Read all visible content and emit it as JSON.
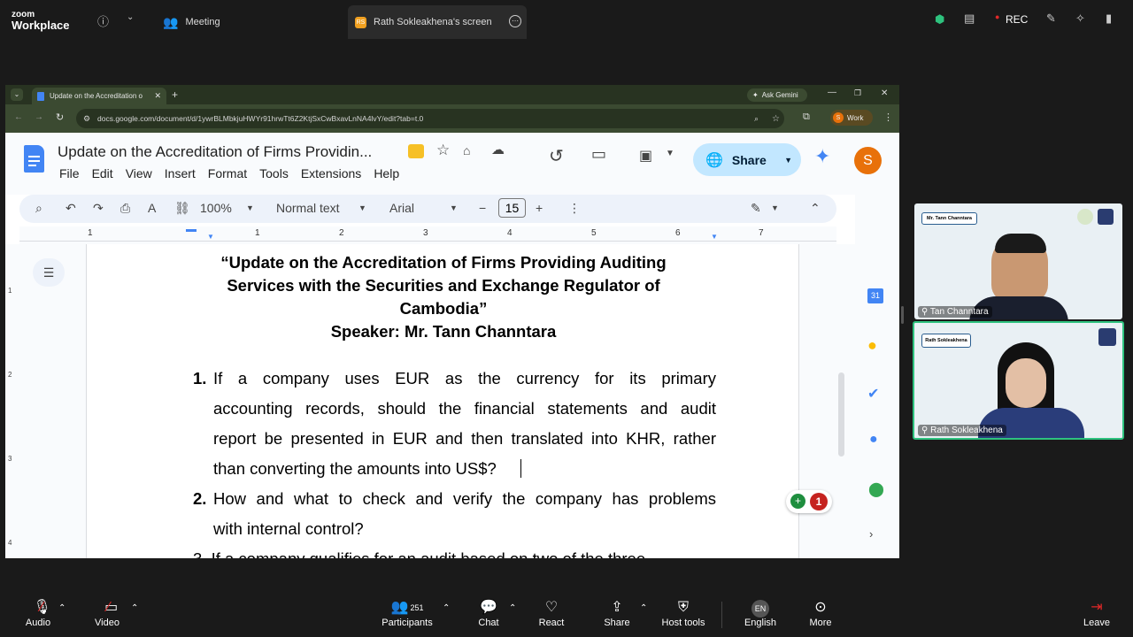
{
  "zoom": {
    "logo_small": "zoom",
    "logo_big": "Workplace",
    "tabs": {
      "meeting": "Meeting",
      "screen": "Rath Sokleakhena's screen"
    },
    "rec_label": "REC",
    "screen_tab_initials": "RS"
  },
  "chrome": {
    "tab_title": "Update on the Accreditation o",
    "ask_gemini": "Ask Gemini",
    "url": "docs.google.com/document/d/1ywrBLMbkjuHWYr91hrwTt6Z2KtjSxCwBxavLnNA4lvY/edit?tab=t.0",
    "profile": "Work",
    "profile_initial": "S"
  },
  "docs": {
    "title": "Update on the Accreditation of Firms Providin...",
    "menu": [
      "File",
      "Edit",
      "View",
      "Insert",
      "Format",
      "Tools",
      "Extensions",
      "Help"
    ],
    "share": "Share",
    "avatar": "S",
    "zoom": "100%",
    "style": "Normal text",
    "font": "Arial",
    "font_size": "15",
    "ruler": [
      "1",
      "1",
      "2",
      "3",
      "4",
      "5",
      "6",
      "7"
    ],
    "side_ruler": [
      "1",
      "2",
      "3",
      "4"
    ],
    "comment_count": "1"
  },
  "content": {
    "heading": [
      "“Update on the Accreditation of Firms Providing Auditing",
      "Services with the Securities and Exchange Regulator of",
      "Cambodia”",
      "Speaker: Mr. Tann Channtara"
    ],
    "q1_num": "1.",
    "q1": [
      "If a company uses EUR as the currency for its primary",
      "accounting records, should the financial statements and audit",
      "report be presented in EUR and then translated into KHR, rather",
      "than converting the amounts into US$?"
    ],
    "q2_num": "2.",
    "q2": [
      "How and what to check and verify the company has problems",
      "with internal control?"
    ],
    "q3_partial": "3. If a company qualifies for an audit based on two of the three"
  },
  "participants_gallery": [
    {
      "name": "Tan Channtara",
      "badge": "Mr. Tann Channtara"
    },
    {
      "name": "Rath Sokleakhena",
      "badge": "Rath Sokleakhena"
    }
  ],
  "bottom": {
    "audio": "Audio",
    "video": "Video",
    "participants": "Participants",
    "participants_count": "251",
    "chat": "Chat",
    "react": "React",
    "share": "Share",
    "host_tools": "Host tools",
    "english": "English",
    "english_badge": "EN",
    "more": "More",
    "leave": "Leave"
  },
  "colors": {
    "rec": "#e02828",
    "share_btn": "#c2e7ff",
    "avatar": "#e8710a",
    "chrome_bg": "#3b4a31"
  }
}
